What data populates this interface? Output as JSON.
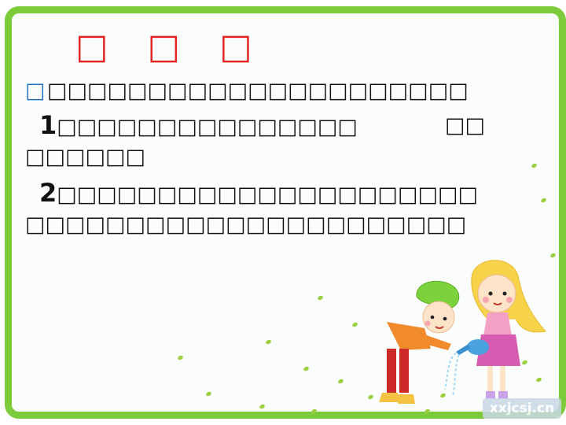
{
  "title": "□ □ □",
  "bullet_icon": "square-bullet",
  "lines": {
    "l1": "□□□□□□□□□□□□□□□□□□□□□",
    "l2_num": "1",
    "l2_a": "□□□□□□□□□□□□□□□",
    "l2_b": "□□",
    "l3": "□□□□□□",
    "l4_num": "2",
    "l4": "□□□□□□□□□□□□□□□□□□□□□",
    "l5": "□□□□□□□□□□□□□□□□□□□□□□"
  },
  "watermark": "xxjcsj.cn",
  "colors": {
    "frame": "#7ccb3a",
    "title": "#e52222",
    "bullet": "#1f6fc0"
  }
}
